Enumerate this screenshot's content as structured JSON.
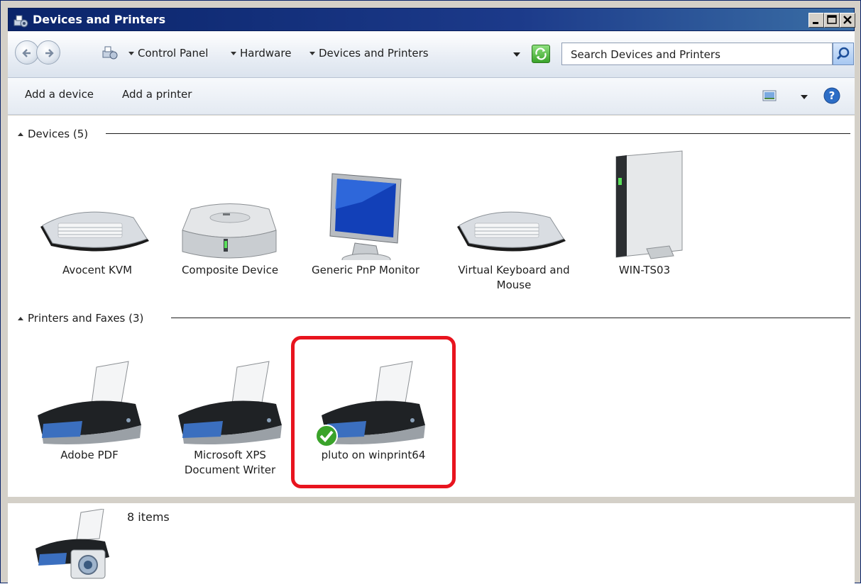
{
  "window": {
    "title": "Devices and Printers"
  },
  "address_bar": {
    "breadcrumbs": [
      "Control Panel",
      "Hardware",
      "Devices and Printers"
    ],
    "search_placeholder": "Search Devices and Printers"
  },
  "command_bar": {
    "add_device": "Add a device",
    "add_printer": "Add a printer"
  },
  "groups": {
    "devices": {
      "header": "Devices (5)",
      "items": [
        {
          "name": "Avocent KVM",
          "icon": "keyboard-icon"
        },
        {
          "name": "Composite Device",
          "icon": "external-drive-icon"
        },
        {
          "name": "Generic PnP Monitor",
          "icon": "monitor-icon"
        },
        {
          "name": "Virtual Keyboard and Mouse",
          "icon": "keyboard-icon"
        },
        {
          "name": "WIN-TS03",
          "icon": "computer-tower-icon"
        }
      ]
    },
    "printers": {
      "header": "Printers and Faxes (3)",
      "items": [
        {
          "name": "Adobe PDF",
          "icon": "printer-icon"
        },
        {
          "name": "Microsoft XPS Document Writer",
          "icon": "printer-icon"
        },
        {
          "name": "pluto on winprint64",
          "icon": "printer-icon",
          "default": true
        }
      ]
    }
  },
  "details_pane": {
    "count": "8 items",
    "icon": "printer-camera-icon"
  },
  "colors": {
    "titlebar": "#0a246a",
    "selection_highlight": "#e8141e",
    "default_check": "#3aa32a"
  }
}
